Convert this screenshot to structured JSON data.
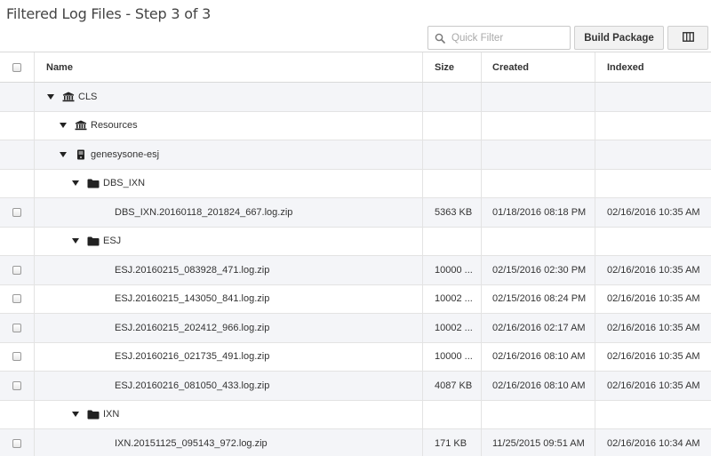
{
  "page": {
    "title": "Filtered Log Files - Step 3 of 3"
  },
  "toolbar": {
    "filter_placeholder": "Quick Filter",
    "build_package_label": "Build Package"
  },
  "columns": {
    "name": "Name",
    "size": "Size",
    "created": "Created",
    "indexed": "Indexed"
  },
  "rows": [
    {
      "type": "folder",
      "icon": "bank",
      "depth": 0,
      "name": "CLS"
    },
    {
      "type": "folder",
      "icon": "bank",
      "depth": 1,
      "name": "Resources"
    },
    {
      "type": "folder",
      "icon": "server",
      "depth": 1,
      "name": "genesysone-esj"
    },
    {
      "type": "folder",
      "icon": "folder",
      "depth": 2,
      "name": "DBS_IXN"
    },
    {
      "type": "file",
      "name": "DBS_IXN.20160118_201824_667.log.zip",
      "size": "5363 KB",
      "created": "01/18/2016 08:18 PM",
      "indexed": "02/16/2016 10:35 AM"
    },
    {
      "type": "folder",
      "icon": "folder",
      "depth": 2,
      "name": "ESJ"
    },
    {
      "type": "file",
      "name": "ESJ.20160215_083928_471.log.zip",
      "size": "10000 ...",
      "created": "02/15/2016 02:30 PM",
      "indexed": "02/16/2016 10:35 AM"
    },
    {
      "type": "file",
      "name": "ESJ.20160215_143050_841.log.zip",
      "size": "10002 ...",
      "created": "02/15/2016 08:24 PM",
      "indexed": "02/16/2016 10:35 AM"
    },
    {
      "type": "file",
      "name": "ESJ.20160215_202412_966.log.zip",
      "size": "10002 ...",
      "created": "02/16/2016 02:17 AM",
      "indexed": "02/16/2016 10:35 AM"
    },
    {
      "type": "file",
      "name": "ESJ.20160216_021735_491.log.zip",
      "size": "10000 ...",
      "created": "02/16/2016 08:10 AM",
      "indexed": "02/16/2016 10:35 AM"
    },
    {
      "type": "file",
      "name": "ESJ.20160216_081050_433.log.zip",
      "size": "4087 KB",
      "created": "02/16/2016 08:10 AM",
      "indexed": "02/16/2016 10:35 AM"
    },
    {
      "type": "folder",
      "icon": "folder",
      "depth": 2,
      "name": "IXN"
    },
    {
      "type": "file",
      "name": "IXN.20151125_095143_972.log.zip",
      "size": "171 KB",
      "created": "11/25/2015 09:51 AM",
      "indexed": "02/16/2016 10:34 AM"
    }
  ],
  "icons": {
    "search": "search-icon",
    "columns": "columns-icon",
    "caret": "caret-down-icon",
    "bank": "bank-icon",
    "server": "server-icon",
    "folder": "folder-icon"
  },
  "colors": {
    "row_alt": "#f4f5f8",
    "border": "#e3e3e3",
    "button_bg": "#f2f2f2"
  }
}
